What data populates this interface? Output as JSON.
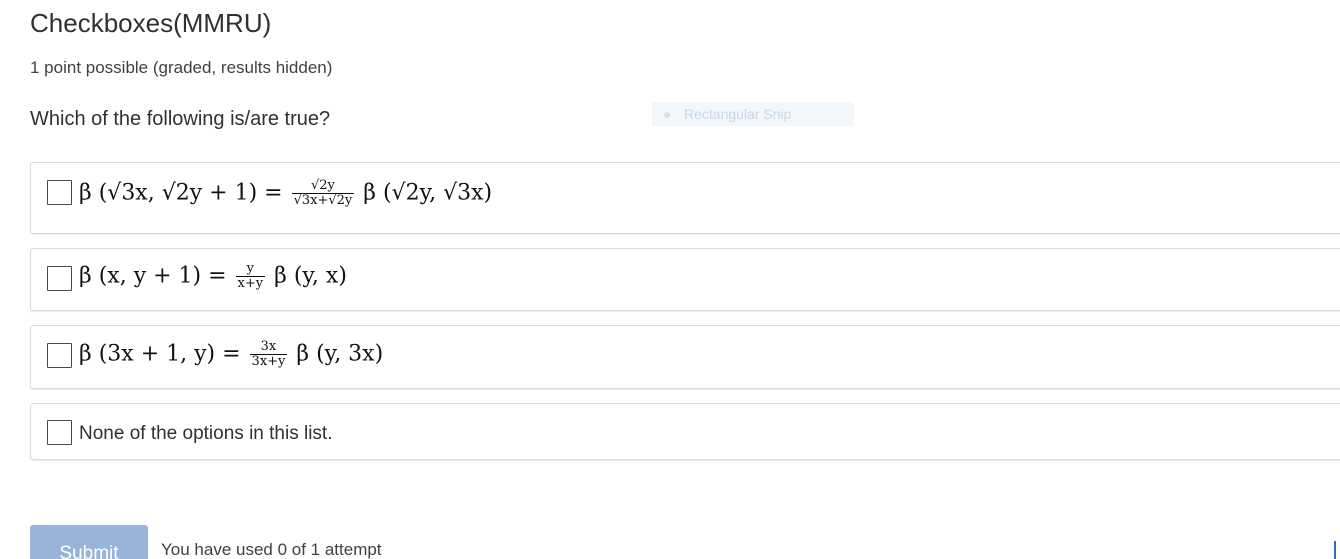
{
  "problem": {
    "title": "Checkboxes(MMRU)",
    "points": "1 point possible (graded, results hidden)",
    "question": "Which of the following is/are true?"
  },
  "overlay": {
    "snip_label": "Rectangular Snip"
  },
  "options": [
    {
      "lhs": "β (√3x, √2y + 1) =",
      "frac_num": "√2y",
      "frac_den": "√3x+√2y",
      "rhs": "β (√2y, √3x)"
    },
    {
      "lhs": "β (x, y + 1) =",
      "frac_num": "y",
      "frac_den": "x+y",
      "rhs": "β (y, x)"
    },
    {
      "lhs": "β (3x + 1, y) =",
      "frac_num": "3x",
      "frac_den": "3x+y",
      "rhs": "β (y, 3x)"
    },
    {
      "text": "None of the options in this list."
    }
  ],
  "footer": {
    "submit_label": "Submit",
    "attempts_text": "You have used 0 of 1 attempt"
  }
}
